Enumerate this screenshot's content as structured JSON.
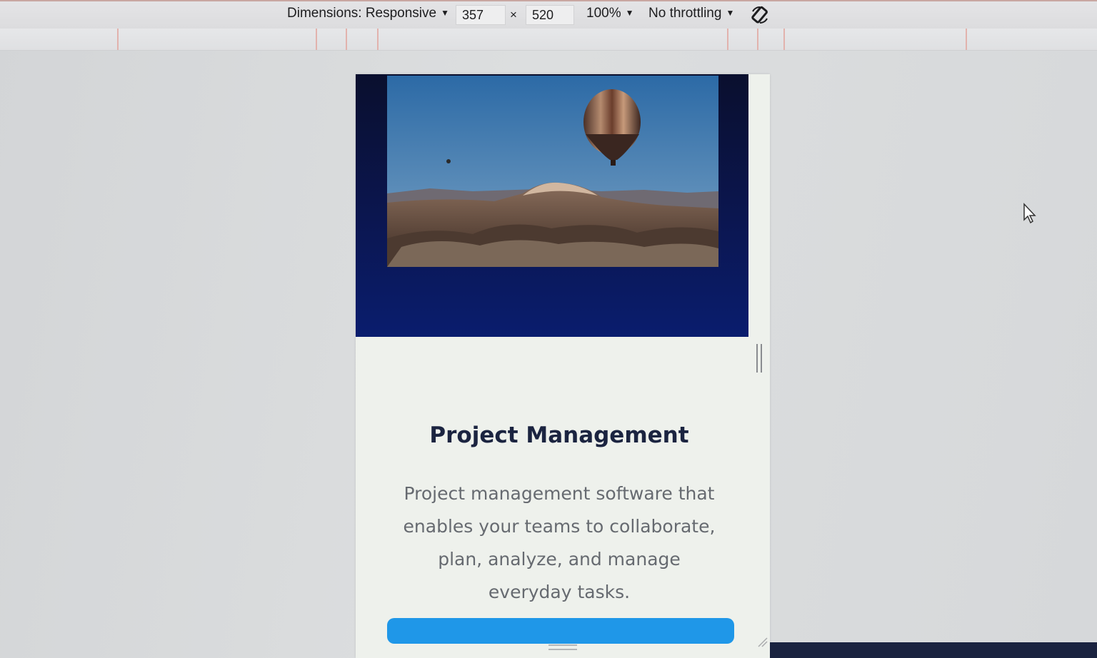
{
  "toolbar": {
    "dimensions_label": "Dimensions: Responsive",
    "width_value": "357",
    "times_symbol": "×",
    "height_value": "520",
    "zoom_label": "100%",
    "throttle_label": "No throttling",
    "rotate_icon": "rotate-icon"
  },
  "card": {
    "image_icon": "hot-air-balloon-photo",
    "title": "Project Management",
    "description": "Project management software that enables your teams to collaborate, plan, analyze, and manage everyday tasks.",
    "button_color": "#1f97e8"
  },
  "colors": {
    "hero_background": "#0b1650",
    "card_background": "#eef1ec",
    "title_color": "#1b2440",
    "text_color": "#666a70"
  }
}
